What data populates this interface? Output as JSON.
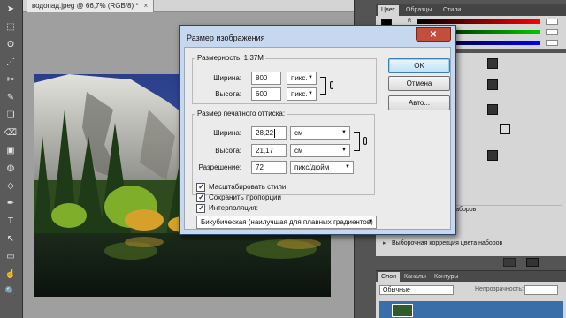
{
  "document": {
    "tab_title": "водопад.jpeg @ 66,7% (RGB/8) *",
    "close_glyph": "×"
  },
  "tools": [
    "➤",
    "⬚",
    "ʘ",
    "⋰",
    "✂",
    "✎",
    "❏",
    "⌫",
    "▣",
    "◍",
    "◇",
    "✒",
    "T",
    "↖",
    "▭",
    "☝",
    "🔍"
  ],
  "dialog": {
    "title": "Размер изображения",
    "close_glyph": "✕",
    "pixel_group": {
      "dimension_label": "Размерность:",
      "dimension_value": "1,37М",
      "width_label": "Ширина:",
      "width_value": "800",
      "width_unit": "пикс.",
      "height_label": "Высота:",
      "height_value": "600",
      "height_unit": "пикс."
    },
    "print_group": {
      "title": "Размер печатного оттиска:",
      "width_label": "Ширина:",
      "width_value": "28,22",
      "width_unit": "см",
      "height_label": "Высота:",
      "height_value": "21,17",
      "height_unit": "см",
      "resolution_label": "Разрешение:",
      "resolution_value": "72",
      "resolution_unit": "пикс/дюйм"
    },
    "checkboxes": {
      "scale_styles": "Масштабировать стили",
      "constrain": "Сохранить пропорции",
      "resample": "Интерполяция:"
    },
    "interpolation_value": "Бикубическая (наилучшая для плавных градиентов)",
    "buttons": {
      "ok": "OK",
      "cancel": "Отмена",
      "auto": "Авто..."
    }
  },
  "panels": {
    "color_tabs": [
      "Цвет",
      "Образцы",
      "Стили"
    ],
    "color_channel_label": "R",
    "adjustment_items": [
      "Цветовая коррекция наборов",
      "Выборочная коррекция цвета наборов"
    ],
    "layer_tabs": [
      "Слои",
      "Каналы",
      "Контуры"
    ],
    "blend_mode": "Обычные",
    "opacity_label": "Непрозрачность:"
  },
  "colors": {
    "dialog_frame": "#c6d8ef",
    "default_button": "#bfe1f8",
    "close_button": "#c44e3c",
    "layer_selected": "#3a6ea8"
  }
}
